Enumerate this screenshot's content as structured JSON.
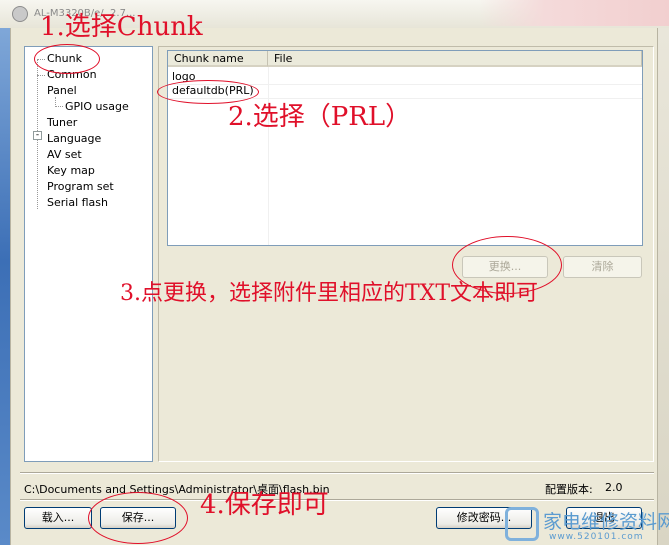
{
  "window": {
    "title": "AL-M3320B/e/..2.7..."
  },
  "tree": {
    "items": [
      {
        "label": "Chunk"
      },
      {
        "label": "Common"
      },
      {
        "label": "Panel"
      },
      {
        "label": "GPIO usage"
      },
      {
        "label": "Tuner"
      },
      {
        "label": "Language"
      },
      {
        "label": "AV set"
      },
      {
        "label": "Key map"
      },
      {
        "label": "Program set"
      },
      {
        "label": "Serial flash"
      }
    ],
    "expander": "-"
  },
  "list": {
    "columns": [
      "Chunk name",
      "File"
    ],
    "rows": [
      {
        "name": "logo",
        "file": ""
      },
      {
        "name": "defaultdb(PRL)",
        "file": ""
      }
    ]
  },
  "buttons": {
    "replace": "更换...",
    "clear": "清除",
    "load": "载入...",
    "save": "保存...",
    "change_password": "修改密码...",
    "exit": "退出"
  },
  "status": {
    "path": "C:\\Documents and Settings\\Administrator\\桌面\\flash.bin",
    "version_label": "配置版本:",
    "version_value": "2.0"
  },
  "annotations": {
    "step1": "1.选择Chunk",
    "step2": "2.选择（PRL）",
    "step3": "3.点更换，选择附件里相应的TXT文本即可",
    "step4": "4.保存即可"
  },
  "watermark": {
    "text": "家电维修资料网",
    "url": "www.520101.com"
  },
  "colors": {
    "annotation": "#e0102a",
    "watermark": "#5b9bd0",
    "window_bg": "#ece9d8"
  }
}
